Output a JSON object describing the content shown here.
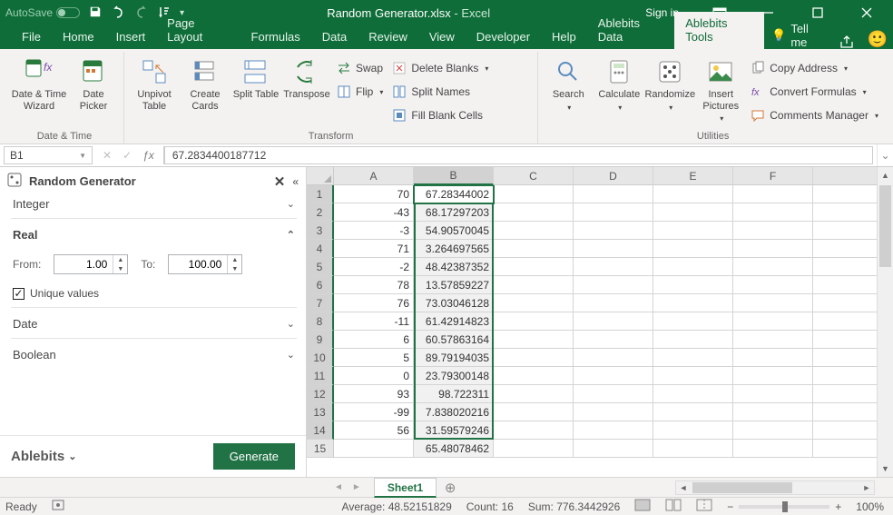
{
  "titlebar": {
    "autosave": "AutoSave",
    "title_file": "Random Generator.xlsx",
    "title_app": "Excel",
    "signin": "Sign in"
  },
  "menu": {
    "file": "File",
    "home": "Home",
    "insert": "Insert",
    "page_layout": "Page Layout",
    "formulas": "Formulas",
    "data": "Data",
    "review": "Review",
    "view": "View",
    "developer": "Developer",
    "help": "Help",
    "able_data": "Ablebits Data",
    "able_tools": "Ablebits Tools",
    "tellme": "Tell me"
  },
  "ribbon": {
    "date_time_wizard": "Date & Time Wizard",
    "date_picker": "Date Picker",
    "group_date": "Date & Time",
    "unpivot_table": "Unpivot Table",
    "create_cards": "Create Cards",
    "split_table": "Split Table",
    "transpose": "Transpose",
    "swap": "Swap",
    "flip": "Flip",
    "delete_blanks": "Delete Blanks",
    "split_names": "Split Names",
    "fill_blank": "Fill Blank Cells",
    "group_transform": "Transform",
    "search": "Search",
    "calculate": "Calculate",
    "randomize": "Randomize",
    "insert_pictures": "Insert Pictures",
    "copy_address": "Copy Address",
    "convert_formulas": "Convert Formulas",
    "comments_mgr": "Comments Manager",
    "group_util": "Utilities"
  },
  "fx": {
    "name": "B1",
    "value": "67.2834400187712"
  },
  "panel": {
    "title": "Random Generator",
    "integer": "Integer",
    "real": "Real",
    "from": "From:",
    "to": "To:",
    "from_val": "1.00",
    "to_val": "100.00",
    "unique": "Unique values",
    "date": "Date",
    "boolean": "Boolean",
    "brand": "Ablebits",
    "generate": "Generate"
  },
  "grid": {
    "cols": [
      "A",
      "B",
      "C",
      "D",
      "E",
      "F"
    ],
    "rownums": [
      "1",
      "2",
      "3",
      "4",
      "5",
      "6",
      "7",
      "8",
      "9",
      "10",
      "11",
      "12",
      "13",
      "14",
      "15"
    ],
    "A": [
      "70",
      "-43",
      "-3",
      "71",
      "-2",
      "78",
      "76",
      "-11",
      "6",
      "5",
      "0",
      "93",
      "-99",
      "56",
      ""
    ],
    "B": [
      "67.28344002",
      "68.17297203",
      "54.90570045",
      "3.264697565",
      "48.42387352",
      "13.57859227",
      "73.03046128",
      "61.42914823",
      "60.57863164",
      "89.79194035",
      "23.79300148",
      "98.722311",
      "7.838020216",
      "31.59579246",
      "65.48078462"
    ]
  },
  "sheet_tab": "Sheet1",
  "status": {
    "ready": "Ready",
    "avg_label": "Average:",
    "avg": "48.52151829",
    "count_label": "Count:",
    "count": "16",
    "sum_label": "Sum:",
    "sum": "776.3442926",
    "zoom": "100%"
  }
}
